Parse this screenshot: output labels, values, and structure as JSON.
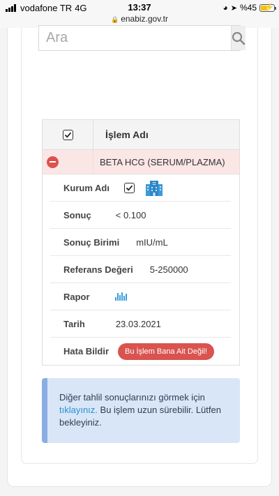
{
  "status_bar": {
    "carrier": "vodafone TR",
    "network": "4G",
    "time": "13:37",
    "url": "enabiz.gov.tr",
    "battery": "%45"
  },
  "search": {
    "placeholder": "Ara"
  },
  "table": {
    "header_label": "İşlem Adı",
    "test_name": "BETA HCG (SERUM/PLAZMA)",
    "details": {
      "kurum_label": "Kurum Adı",
      "sonuc_label": "Sonuç",
      "sonuc_value": "< 0.100",
      "birim_label": "Sonuç Birimi",
      "birim_value": "mIU/mL",
      "referans_label": "Referans Değeri",
      "referans_value": "5-250000",
      "rapor_label": "Rapor",
      "tarih_label": "Tarih",
      "tarih_value": "23.03.2021",
      "hata_label": "Hata Bildir",
      "hata_button": "Bu İşlem Bana Ait Değil!"
    }
  },
  "info": {
    "text_before": "Diğer tahlil sonuçlarınızı görmek için ",
    "link": "tıklayınız.",
    "text_after": " Bu işlem uzun sürebilir. Lütfen bekleyiniz."
  },
  "colors": {
    "danger": "#d9534f",
    "info_bg": "#d9e6f7",
    "link": "#2a8fd0",
    "row_highlight": "#fbe6e6"
  },
  "icons": [
    "signal-icon",
    "lock-icon",
    "location-icon",
    "battery-icon",
    "search-icon",
    "checkbox-icon",
    "remove-icon",
    "hospital-icon",
    "chart-icon"
  ]
}
